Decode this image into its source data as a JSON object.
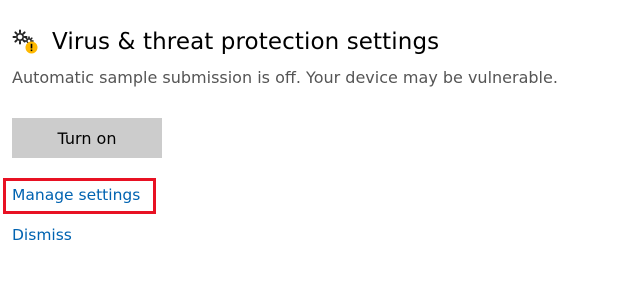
{
  "notification": {
    "icon": "gears-warning-icon",
    "title": "Virus & threat protection settings",
    "description": "Automatic sample submission is off. Your device may be vulnerable.",
    "turn_on_label": "Turn on",
    "manage_settings_label": "Manage settings",
    "dismiss_label": "Dismiss"
  },
  "colors": {
    "link": "#0063b1",
    "button_bg": "#cccccc",
    "highlight": "#e81123",
    "warning": "#ffb900"
  }
}
